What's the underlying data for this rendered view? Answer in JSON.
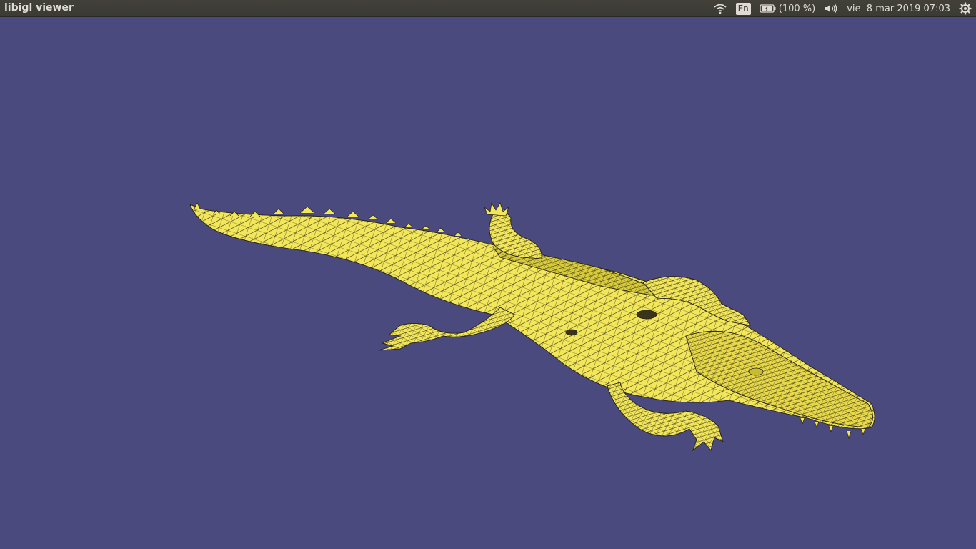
{
  "window": {
    "title": "libigl viewer"
  },
  "indicators": {
    "wifi_icon": "wifi-icon",
    "language": "En",
    "battery_icon": "battery-icon",
    "battery": "(100 %)",
    "volume_icon": "volume-icon",
    "clock": "vie  8 mar 2019 07:03",
    "system_icon": "gear-icon"
  },
  "viewport": {
    "background": "#4b4a7e",
    "mesh_fill": "#f2e65a",
    "wireframe": "#1e1c10",
    "model_icon": "crocodile-mesh"
  }
}
